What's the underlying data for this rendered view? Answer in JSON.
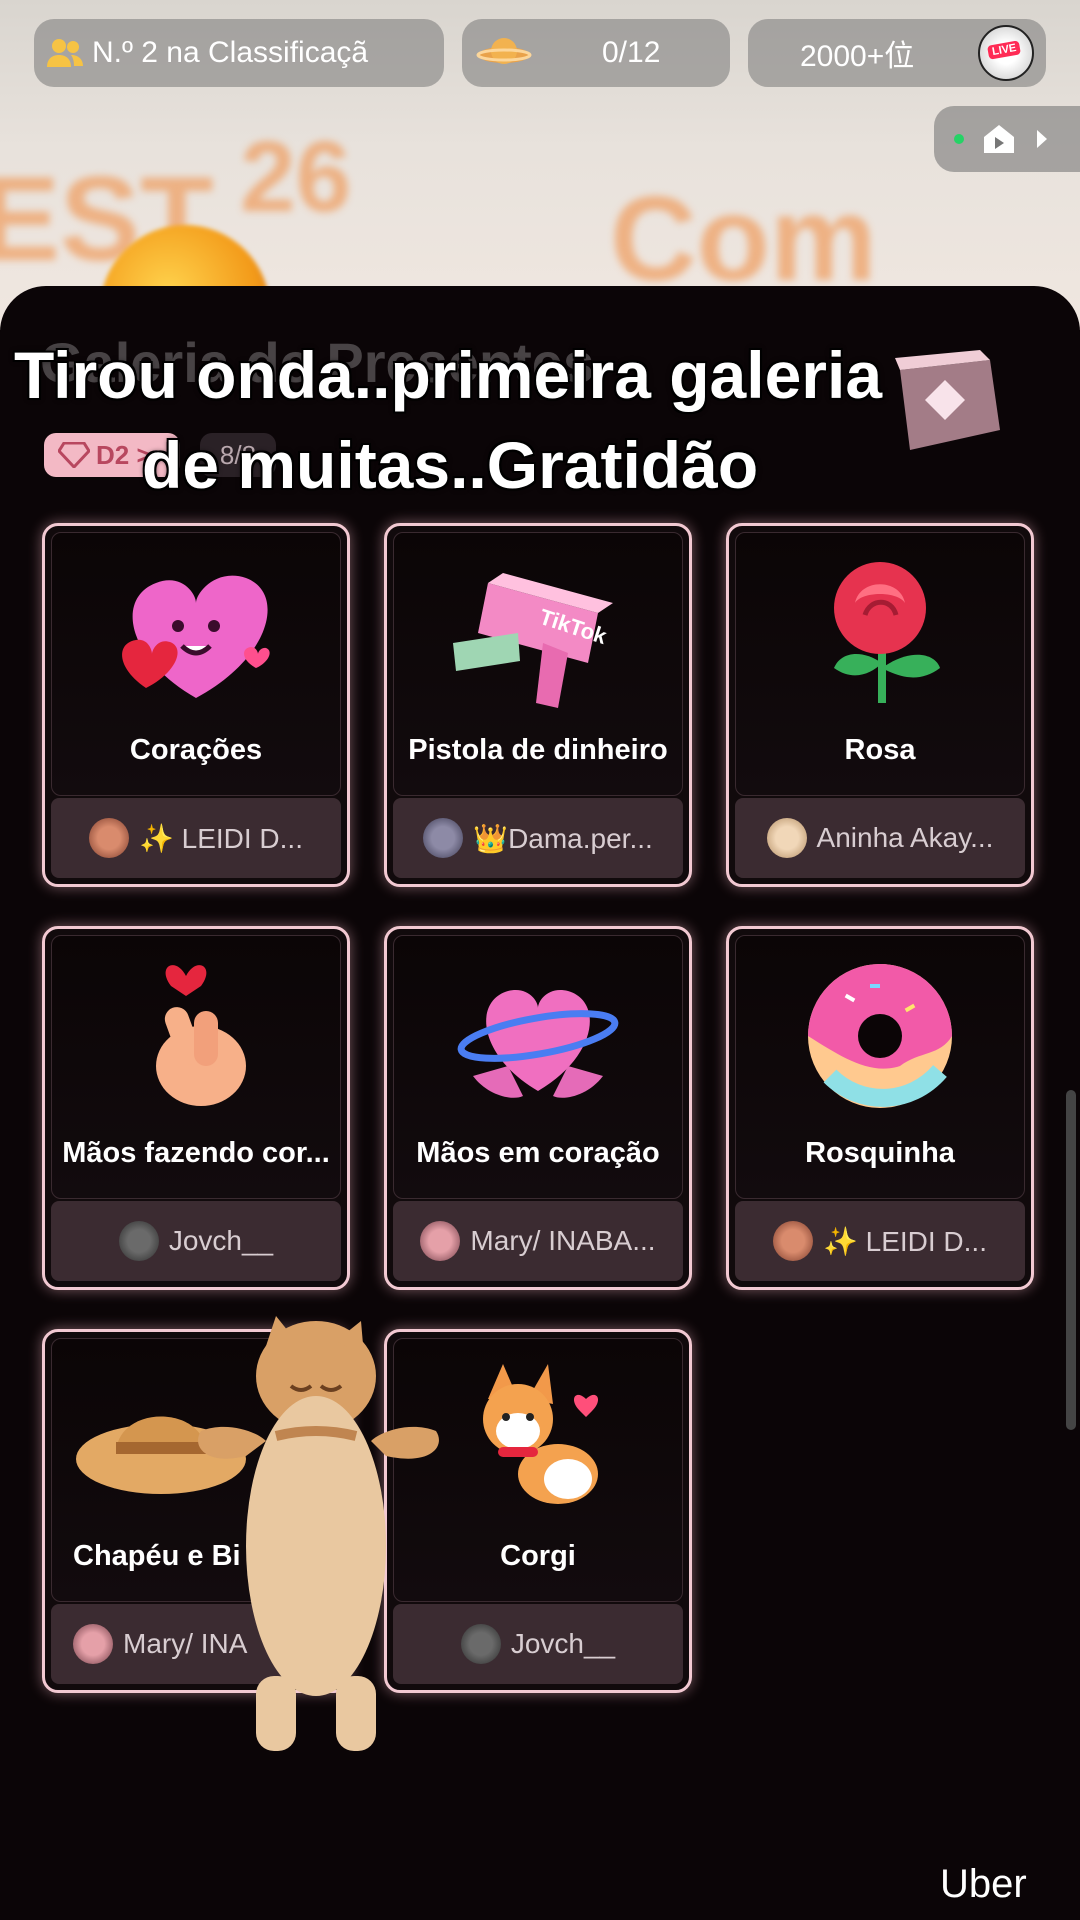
{
  "header": {
    "ranking_label": "N.º 2 na Classificaçã",
    "progress_label": "0/12",
    "rank_label": "2000+位",
    "live_tag": "LIVE"
  },
  "panel": {
    "ghost_title": "Galeria de Presentes",
    "badge": "D2 >",
    "count": "8/8"
  },
  "caption": {
    "line1": "Tirou onda..primeira galeria",
    "line2": "de muitas..Gratidão"
  },
  "gifts": [
    {
      "name": "Corações",
      "user": "✨ LEIDI D...",
      "icon": "hearts-icon"
    },
    {
      "name": "Pistola de dinheiro",
      "user": "👑Dama.per...",
      "icon": "money-gun-icon",
      "gun_text": "TikTok"
    },
    {
      "name": "Rosa",
      "user": "Aninha Akay...",
      "icon": "rose-icon"
    },
    {
      "name": "Mãos fazendo cor...",
      "user": "Jovch__",
      "icon": "finger-heart-icon"
    },
    {
      "name": "Mãos em coração",
      "user": "Mary/ INABA...",
      "icon": "heart-hands-icon"
    },
    {
      "name": "Rosquinha",
      "user": "✨ LEIDI D...",
      "icon": "donut-icon"
    },
    {
      "name": "Chapéu e Bi",
      "user": "Mary/ INA",
      "icon": "hat-icon"
    },
    {
      "name": "Corgi",
      "user": "Jovch__",
      "icon": "corgi-icon"
    }
  ],
  "watermark": "Uber"
}
